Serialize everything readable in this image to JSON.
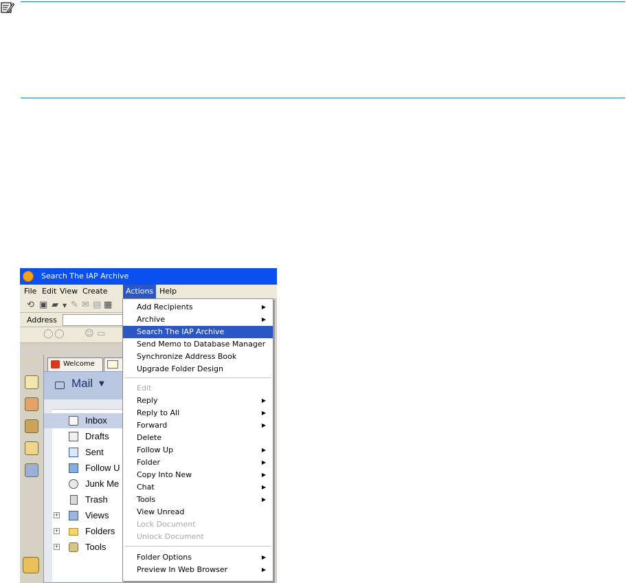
{
  "window": {
    "title": "Search The IAP Archive"
  },
  "menubar": {
    "items": [
      "File",
      "Edit",
      "View",
      "Create",
      "Actions",
      "Help"
    ],
    "active": "Actions"
  },
  "address_bar": {
    "label": "Address"
  },
  "tabs": {
    "welcome": "Welcome"
  },
  "mail": {
    "title": "Mail",
    "nav": [
      {
        "label": "Inbox",
        "icon": "inbox-icon",
        "selected": true
      },
      {
        "label": "Drafts",
        "icon": "drafts-icon"
      },
      {
        "label": "Sent",
        "icon": "sent-icon"
      },
      {
        "label": "Follow U",
        "icon": "follow-up-icon"
      },
      {
        "label": "Junk Me",
        "icon": "junk-mail-icon"
      },
      {
        "label": "Trash",
        "icon": "trash-icon"
      },
      {
        "label": "Views",
        "icon": "views-icon",
        "expandable": true
      },
      {
        "label": "Folders",
        "icon": "folder-icon",
        "expandable": true
      },
      {
        "label": "Tools",
        "icon": "tools-icon",
        "expandable": true
      }
    ]
  },
  "actions_menu": {
    "items": [
      {
        "label": "Add Recipients",
        "submenu": true
      },
      {
        "label": "Archive",
        "submenu": true
      },
      {
        "label": "Search The IAP Archive",
        "highlighted": true
      },
      {
        "label": "Send Memo to Database Manager"
      },
      {
        "label": "Synchronize Address Book"
      },
      {
        "label": "Upgrade Folder Design"
      },
      {
        "separator": true
      },
      {
        "label": "Edit",
        "disabled": true
      },
      {
        "label": "Reply",
        "submenu": true
      },
      {
        "label": "Reply to All",
        "submenu": true
      },
      {
        "label": "Forward",
        "submenu": true
      },
      {
        "label": "Delete"
      },
      {
        "label": "Follow Up",
        "submenu": true
      },
      {
        "label": "Folder",
        "submenu": true
      },
      {
        "label": "Copy Into New",
        "submenu": true
      },
      {
        "label": "Chat",
        "submenu": true
      },
      {
        "label": "Tools",
        "submenu": true
      },
      {
        "label": "View Unread"
      },
      {
        "label": "Lock Document",
        "disabled": true
      },
      {
        "label": "Unlock Document",
        "disabled": true
      },
      {
        "separator": true
      },
      {
        "label": "Folder Options",
        "submenu": true
      },
      {
        "label": "Preview In Web Browser",
        "submenu": true
      }
    ]
  },
  "colors": {
    "titlebar": "#0a50f0",
    "highlight": "#2b57c6",
    "rule": "#1c79c2"
  }
}
